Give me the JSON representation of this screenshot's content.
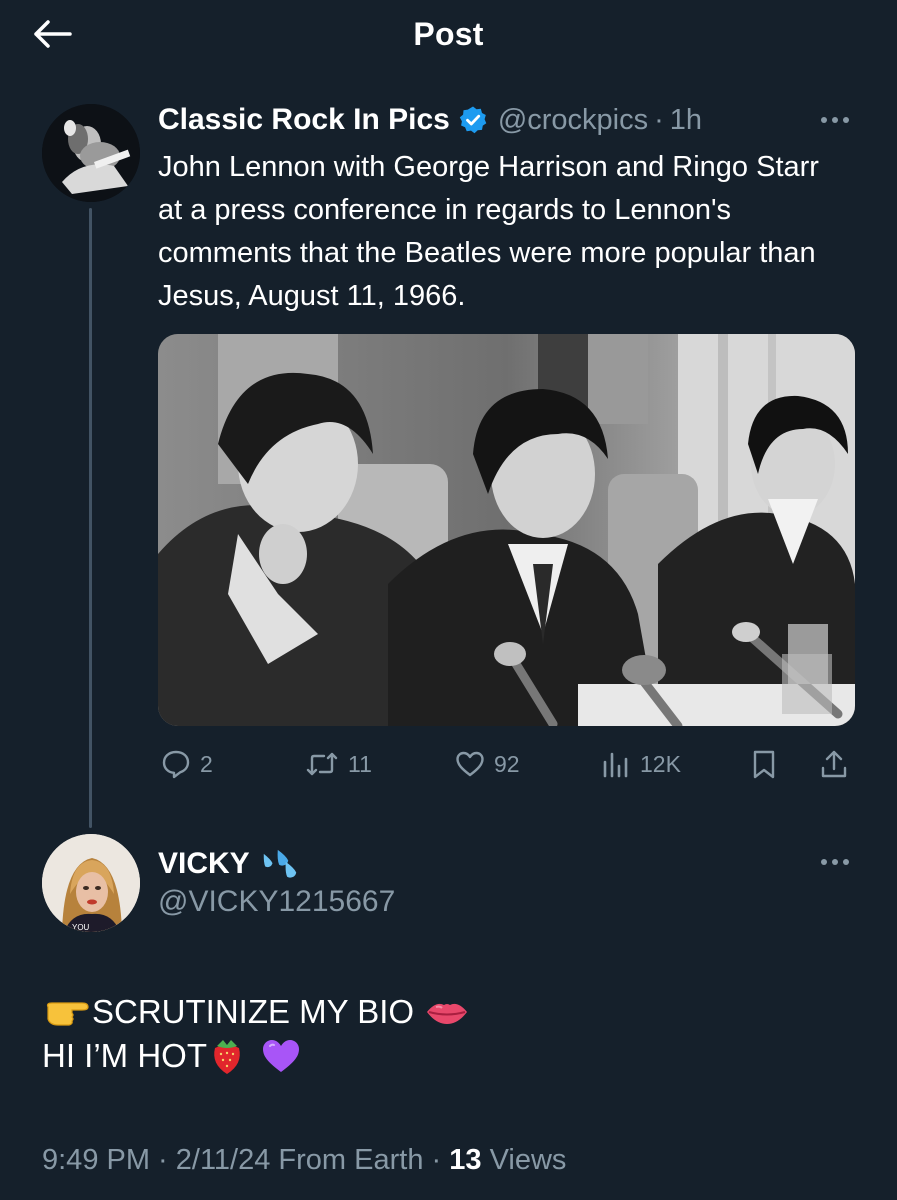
{
  "header": {
    "title": "Post"
  },
  "original_tweet": {
    "display_name": "Classic Rock In Pics",
    "handle": "@crockpics",
    "separator": "·",
    "time": "1h",
    "text": "John Lennon with George Harrison and Ringo Starr at a press conference in regards to Lennon's comments that the Beatles were more popular than Jesus, August 11, 1966.",
    "actions": {
      "replies": "2",
      "retweets": "11",
      "likes": "92",
      "views": "12K"
    }
  },
  "reply_tweet": {
    "display_name": "VICKY",
    "handle": "@VICKY1215667",
    "line1": "SCRUTINIZE MY BIO",
    "line2": "HI I’M HOT",
    "meta_prefix": "9:49 PM · 2/11/24 From Earth ·",
    "views_count": "13",
    "views_label": "Views"
  },
  "colors": {
    "background": "#15202b",
    "muted": "#8899a6",
    "verified": "#1d9bf0",
    "thread_line": "#425364"
  },
  "icons": [
    "back-arrow-icon",
    "verified-badge-icon",
    "more-icon",
    "reply-icon",
    "retweet-icon",
    "like-icon",
    "views-icon",
    "bookmark-icon",
    "share-icon",
    "droplets-emoji-icon",
    "pointing-hand-emoji-icon",
    "lips-emoji-icon",
    "strawberry-emoji-icon",
    "purple-heart-emoji-icon"
  ]
}
